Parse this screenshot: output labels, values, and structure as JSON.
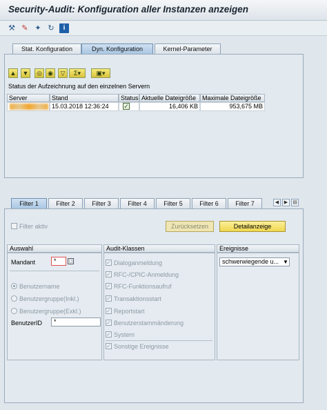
{
  "window": {
    "title": "Security-Audit: Konfiguration aller Instanzen anzeigen"
  },
  "toolbar": {
    "icons": [
      "settings-wand-icon",
      "pencil-icon",
      "wand-icon",
      "refresh-icon",
      "info-icon"
    ],
    "info_glyph": "i"
  },
  "main_tabs": [
    {
      "label": "Stat. Konfiguration",
      "active": false
    },
    {
      "label": "Dyn. Konfiguration",
      "active": true
    },
    {
      "label": "Kernel-Parameter",
      "active": false
    }
  ],
  "grid": {
    "title": "Status der Aufzeichnung auf den einzelnen Servern",
    "columns": [
      "Server",
      "Stand",
      "Status",
      "Aktuelle Dateigröße",
      "Maximale Dateigröße"
    ],
    "rows": [
      {
        "server": "",
        "stand": "15.03.2018 12:36:24",
        "status": "checked",
        "current": "16,406 KB",
        "max": "953,675 MB"
      }
    ]
  },
  "filter_tabs": [
    {
      "label": "Filter 1",
      "active": true
    },
    {
      "label": "Filter 2",
      "active": false
    },
    {
      "label": "Filter 3",
      "active": false
    },
    {
      "label": "Filter 4",
      "active": false
    },
    {
      "label": "Filter 5",
      "active": false
    },
    {
      "label": "Filter 6",
      "active": false
    },
    {
      "label": "Filter 7",
      "active": false
    }
  ],
  "filter": {
    "active_label": "Filter aktiv",
    "reset_label": "Zurücksetzen",
    "details_label": "Detailanzeige"
  },
  "auswahl": {
    "header": "Auswahl",
    "mandant_label": "Mandant",
    "mandant_value": "*",
    "radio_options": [
      "Benutzername",
      "Benutzergruppe(Inkl.)",
      "Benutzergruppe(Exkl.)"
    ],
    "benutzer_label": "BenutzerID",
    "benutzer_value": "*"
  },
  "audit": {
    "header": "Audit-Klassen",
    "classes": [
      "Dialoganmeldung",
      "RFC-/CPIC-Anmeldung",
      "RFC-Funktionsaufruf",
      "Transaktionsstart",
      "Reportstart",
      "Benutzerstammänderung",
      "System",
      "Sonstige Ereignisse"
    ]
  },
  "ereignisse": {
    "header": "Ereignisse",
    "selected": "schwerwiegende u..."
  }
}
